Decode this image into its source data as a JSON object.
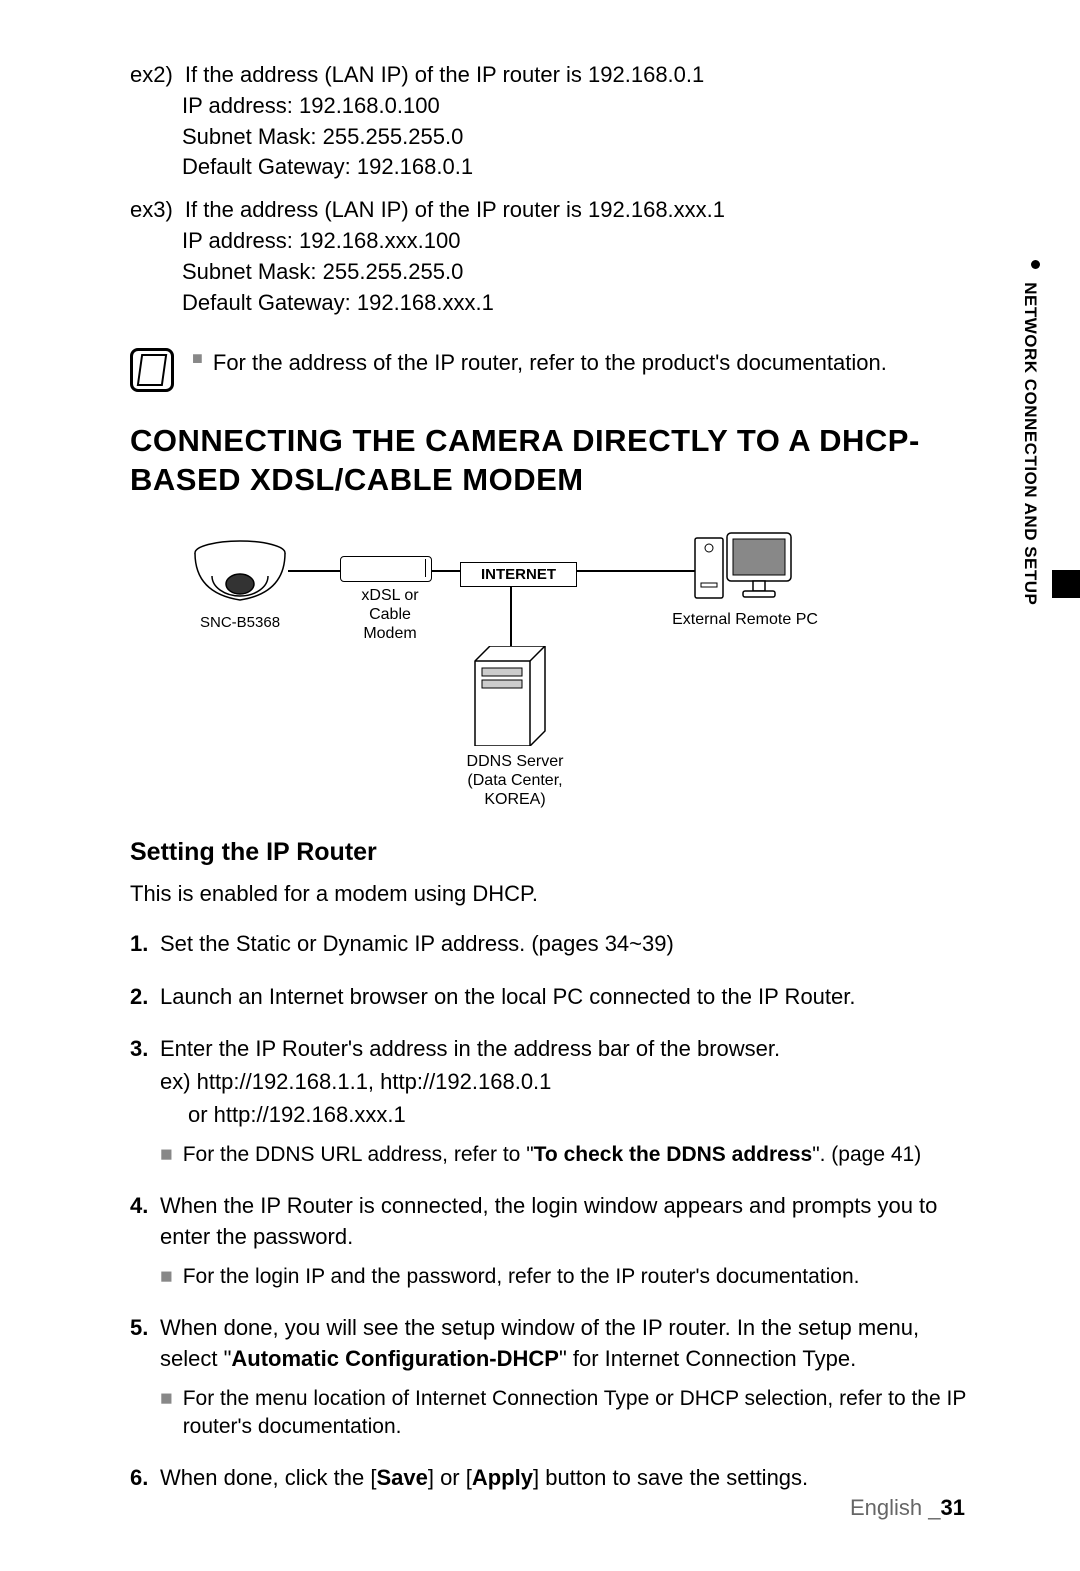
{
  "side_tab": "NETWORK CONNECTION AND SETUP",
  "ex2": {
    "label": "ex2)",
    "line1": "If the address (LAN IP) of the IP router is 192.168.0.1",
    "ip": "IP address: 192.168.0.100",
    "mask": "Subnet Mask: 255.255.255.0",
    "gw": "Default Gateway: 192.168.0.1"
  },
  "ex3": {
    "label": "ex3)",
    "line1": "If the address (LAN IP) of the IP router is 192.168.xxx.1",
    "ip": "IP address: 192.168.xxx.100",
    "mask": "Subnet Mask: 255.255.255.0",
    "gw": "Default Gateway: 192.168.xxx.1"
  },
  "note1": "For the address of the IP router, refer to the product's documentation.",
  "heading": "CONNECTING THE CAMERA DIRECTLY TO A DHCP-BASED XDSL/CABLE MODEM",
  "diagram": {
    "camera": "SNC-B5368",
    "modem_line1": "xDSL or",
    "modem_line2": "Cable Modem",
    "internet": "INTERNET",
    "pc": "External Remote PC",
    "server_line1": "DDNS Server",
    "server_line2": "(Data Center, KOREA)"
  },
  "subheading": "Setting the IP Router",
  "intro": "This is enabled for a modem using DHCP.",
  "steps": {
    "s1": "Set the Static or Dynamic IP address. (pages 34~39)",
    "s2": "Launch an Internet browser on the local PC connected to the IP Router.",
    "s3": "Enter the IP Router's address in the address bar of the browser.",
    "s3_ex1": "ex) http://192.168.1.1, http://192.168.0.1",
    "s3_ex2": "or http://192.168.xxx.1",
    "s3_note_pre": "For the DDNS URL address, refer to \"",
    "s3_note_bold": "To check the DDNS address",
    "s3_note_post": "\". (page 41)",
    "s4": "When the IP Router is connected, the login window appears and prompts you to enter the password.",
    "s4_note": "For the login IP and the password, refer to the IP router's documentation.",
    "s5_pre": "When done, you will see the setup window of the IP router. In the setup menu, select \"",
    "s5_bold": "Automatic Configuration-DHCP",
    "s5_post": "\" for Internet Connection Type.",
    "s5_note": "For the menu location of Internet Connection Type or DHCP selection, refer to the IP router's documentation.",
    "s6_pre": "When done, click the [",
    "s6_b1": "Save",
    "s6_mid": "] or [",
    "s6_b2": "Apply",
    "s6_post": "] button to save the settings."
  },
  "footer": {
    "lang": "English _",
    "page": "31"
  }
}
